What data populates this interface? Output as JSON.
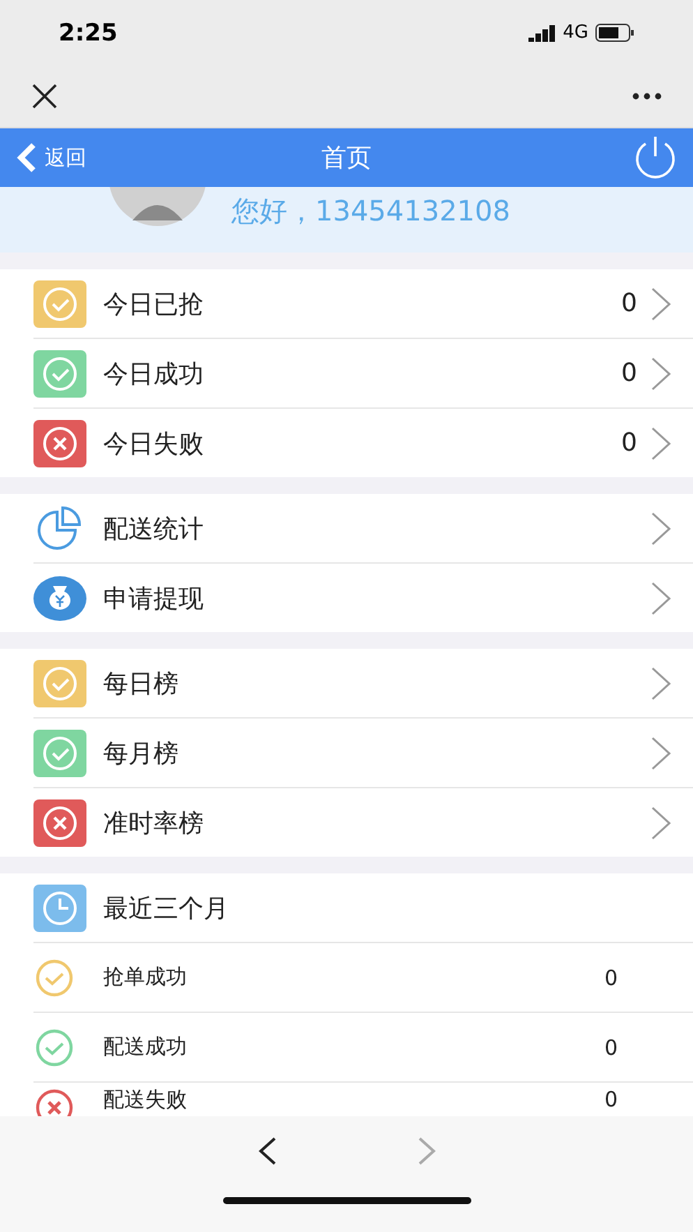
{
  "status_bar": {
    "time": "2:25",
    "network": "4G"
  },
  "header": {
    "back": "返回",
    "title": "首页"
  },
  "profile": {
    "greeting": "您好，13454132108"
  },
  "sections": [
    {
      "kind": "menu",
      "rows": [
        {
          "kind": "check",
          "color": "#f0c86e",
          "label": "今日已抢",
          "value": "0"
        },
        {
          "kind": "check",
          "color": "#7fd6a0",
          "label": "今日成功",
          "value": "0"
        },
        {
          "kind": "cross",
          "color": "#e05a5a",
          "label": "今日失败",
          "value": "0"
        }
      ]
    },
    {
      "kind": "menu",
      "rows": [
        {
          "kind": "pie",
          "color": "#4a9be0",
          "label": "配送统计"
        },
        {
          "kind": "bag",
          "color": "#3f8fd8",
          "label": "申请提现"
        }
      ]
    },
    {
      "kind": "menu",
      "rows": [
        {
          "kind": "check",
          "color": "#f0c86e",
          "label": "每日榜"
        },
        {
          "kind": "check",
          "color": "#7fd6a0",
          "label": "每月榜"
        },
        {
          "kind": "cross",
          "color": "#e05a5a",
          "label": "准时率榜"
        }
      ]
    },
    {
      "kind": "summary",
      "rows": [
        {
          "kind": "clock",
          "color": "#7cbcec",
          "label": "最近三个月"
        },
        {
          "kind": "check",
          "color": "#f0c86e",
          "label": "抢单成功",
          "value": "0"
        },
        {
          "kind": "check",
          "color": "#7fd6a0",
          "label": "配送成功",
          "value": "0"
        },
        {
          "kind": "cross",
          "color": "#e05a5a",
          "label": "配送失败",
          "value": "0"
        }
      ]
    }
  ]
}
